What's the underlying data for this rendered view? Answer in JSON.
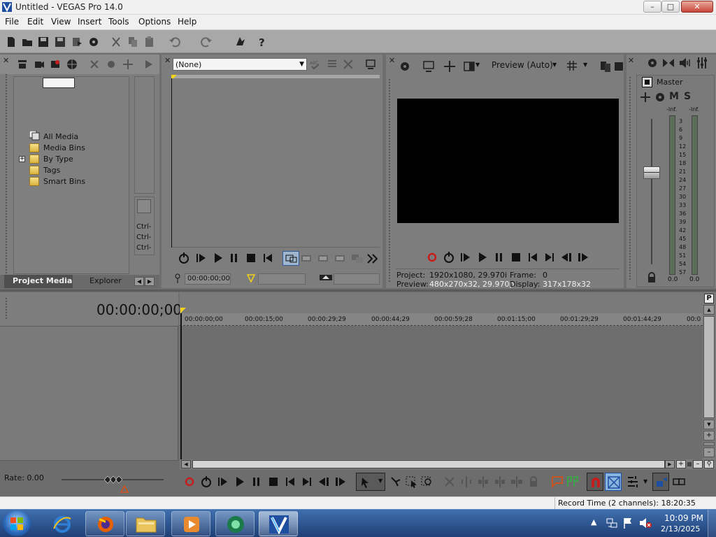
{
  "window": {
    "title": "Untitled - VEGAS Pro 14.0",
    "controls": [
      "minimize",
      "maximize",
      "close"
    ]
  },
  "menu": [
    "File",
    "Edit",
    "View",
    "Insert",
    "Tools",
    "Options",
    "Help"
  ],
  "toolbar": {
    "icons": [
      "new-icon",
      "open-icon",
      "save-icon",
      "save-as-icon",
      "render-icon",
      "properties-icon",
      "cut-icon",
      "copy-icon",
      "paste-icon",
      "undo-icon",
      "redo-icon",
      "enable-snapping-icon",
      "whats-this-help-icon"
    ]
  },
  "project_media": {
    "tree": [
      {
        "label": "All Media",
        "selected": true
      },
      {
        "label": "Media Bins"
      },
      {
        "label": "By Type",
        "expandable": true
      },
      {
        "label": "Tags"
      },
      {
        "label": "Smart Bins"
      }
    ],
    "side_keys": [
      "Ctrl-",
      "Ctrl-",
      "Ctrl-"
    ],
    "tabs": [
      "Project Media",
      "Explorer"
    ],
    "active_tab": "Project Media"
  },
  "trimmer": {
    "media_select": "(None)",
    "timecode": "00:00:00;00"
  },
  "preview": {
    "quality": "Preview (Auto)",
    "project_label": "Project:",
    "project_value": "1920x1080, 29.970i",
    "frame_label": "Frame:",
    "frame_value": "0",
    "preview_label": "Preview:",
    "preview_value": "480x270x32, 29.970p",
    "display_label": "Display:",
    "display_value": "317x178x32"
  },
  "master_bus": {
    "title": "Master",
    "buttons": [
      "M",
      "S"
    ],
    "peak_left": "-Inf.",
    "peak_right": "-Inf.",
    "scale": [
      "3",
      "6",
      "9",
      "12",
      "15",
      "18",
      "21",
      "24",
      "27",
      "30",
      "33",
      "36",
      "39",
      "42",
      "45",
      "48",
      "51",
      "54",
      "57"
    ],
    "level_left": "0.0",
    "level_right": "0.0"
  },
  "timeline": {
    "timecode": "00:00:00;00",
    "ruler": [
      "00:00:00;00",
      "00:00:15;00",
      "00:00:29;29",
      "00:00:44;29",
      "00:00:59;28",
      "00:01:15;00",
      "00:01:29;29",
      "00:01:44;29",
      "00:0"
    ],
    "rate": "Rate: 0.00",
    "record_time": "Record Time (2 channels): 18:20:35"
  },
  "taskbar": {
    "apps": [
      "start-button",
      "internet-explorer",
      "firefox",
      "file-explorer",
      "media-player",
      "media-center",
      "vegas-pro"
    ],
    "time": "10:09 PM",
    "date": "2/13/2025"
  },
  "colors": {
    "panel_bg": "#7d7d7d",
    "toolbar_bg": "#a8a8a8",
    "taskbar": "#2a5396",
    "record_red": "#c41d1d",
    "accent_blue": "#2e7fd6"
  }
}
